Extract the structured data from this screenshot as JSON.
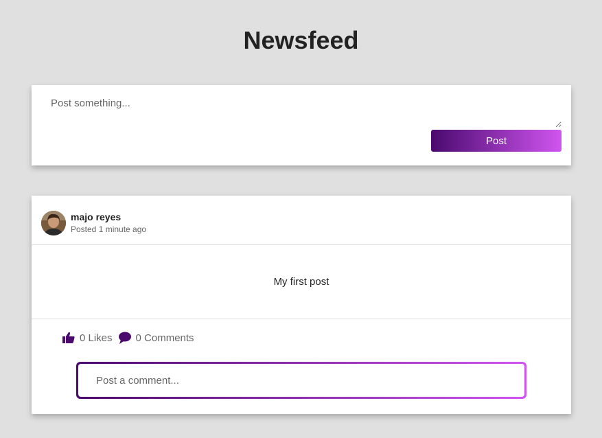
{
  "page": {
    "title": "Newsfeed"
  },
  "composer": {
    "placeholder": "Post something...",
    "post_label": "Post"
  },
  "post": {
    "author": "majo reyes",
    "time": "Posted 1 minute ago",
    "content": "My first post",
    "likes": "0 Likes",
    "comments": "0 Comments",
    "comment_placeholder": "Post a comment..."
  },
  "icons": {
    "like": "thumbs-up-icon",
    "comment": "speech-bubble-icon"
  },
  "colors": {
    "background": "#e0e0e0",
    "accent_dark": "#4a0a6e",
    "accent_light": "#d055f0",
    "icon": "#4a0a6e"
  }
}
